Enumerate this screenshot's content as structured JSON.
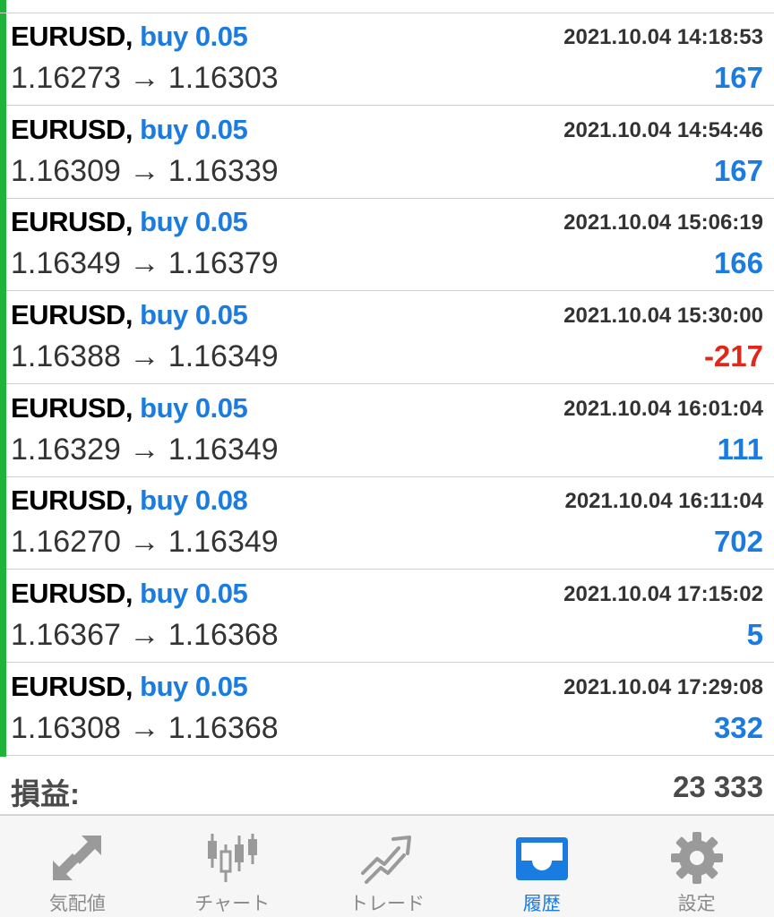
{
  "trades": [
    {
      "symbol": "EURUSD,",
      "side": "buy 0.05",
      "time": "2021.10.04 14:18:53",
      "prices": "1.16273 → 1.16303",
      "profit": "167",
      "profit_sign": "pos"
    },
    {
      "symbol": "EURUSD,",
      "side": "buy 0.05",
      "time": "2021.10.04 14:54:46",
      "prices": "1.16309 → 1.16339",
      "profit": "167",
      "profit_sign": "pos"
    },
    {
      "symbol": "EURUSD,",
      "side": "buy 0.05",
      "time": "2021.10.04 15:06:19",
      "prices": "1.16349 → 1.16379",
      "profit": "166",
      "profit_sign": "pos"
    },
    {
      "symbol": "EURUSD,",
      "side": "buy 0.05",
      "time": "2021.10.04 15:30:00",
      "prices": "1.16388 → 1.16349",
      "profit": "-217",
      "profit_sign": "neg"
    },
    {
      "symbol": "EURUSD,",
      "side": "buy 0.05",
      "time": "2021.10.04 16:01:04",
      "prices": "1.16329 → 1.16349",
      "profit": "111",
      "profit_sign": "pos"
    },
    {
      "symbol": "EURUSD,",
      "side": "buy 0.08",
      "time": "2021.10.04 16:11:04",
      "prices": "1.16270 → 1.16349",
      "profit": "702",
      "profit_sign": "pos"
    },
    {
      "symbol": "EURUSD,",
      "side": "buy 0.05",
      "time": "2021.10.04 17:15:02",
      "prices": "1.16367 → 1.16368",
      "profit": "5",
      "profit_sign": "pos"
    },
    {
      "symbol": "EURUSD,",
      "side": "buy 0.05",
      "time": "2021.10.04 17:29:08",
      "prices": "1.16308 → 1.16368",
      "profit": "332",
      "profit_sign": "pos"
    }
  ],
  "summary": {
    "label": "損益:",
    "value": "23 333"
  },
  "tabbar": {
    "tabs": [
      {
        "label": "気配値",
        "icon": "quotes-arrows-icon",
        "active": false
      },
      {
        "label": "チャート",
        "icon": "candlestick-chart-icon",
        "active": false
      },
      {
        "label": "トレード",
        "icon": "trade-trend-icon",
        "active": false
      },
      {
        "label": "履歴",
        "icon": "history-inbox-icon",
        "active": true
      },
      {
        "label": "設定",
        "icon": "gear-icon",
        "active": false
      }
    ]
  },
  "colors": {
    "accent": "#1a7be0",
    "loss": "#e0271a",
    "trade_bar": "#1fb33a",
    "inactive_icon": "#9a9a9a"
  }
}
